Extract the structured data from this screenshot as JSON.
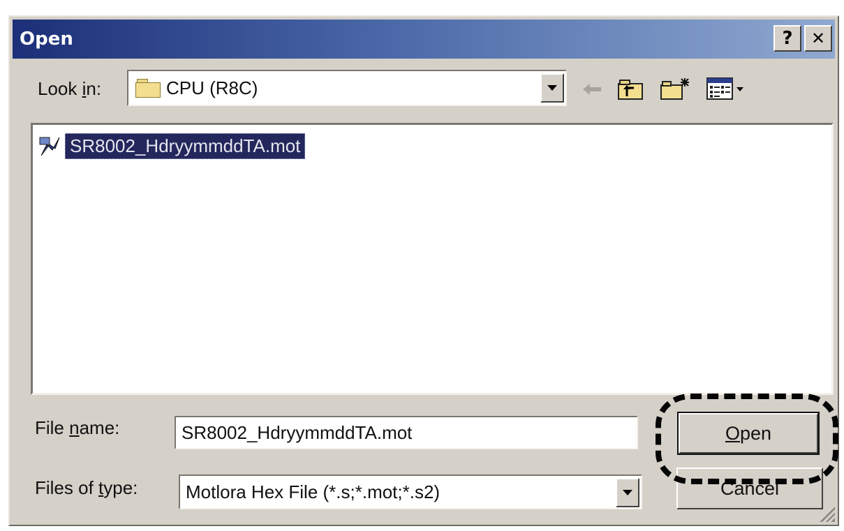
{
  "window": {
    "title": "Open",
    "help_button": "?",
    "close_button": "✕"
  },
  "lookin": {
    "label_pre": "Look ",
    "label_acc": "i",
    "label_post": "n:",
    "value": "CPU (R8C)"
  },
  "toolbar": {
    "back_icon": "back-arrow-icon",
    "up_icon": "up-one-level-icon",
    "new_folder_icon": "new-folder-icon",
    "view_menu_icon": "view-menu-icon"
  },
  "files": [
    {
      "name": "SR8002_HdryymmddTA.mot",
      "selected": true
    }
  ],
  "filename": {
    "label_pre": "File ",
    "label_acc": "n",
    "label_post": "ame:",
    "value": "SR8002_HdryymmddTA.mot"
  },
  "filetype": {
    "label_pre": "Files of ",
    "label_acc": "t",
    "label_post": "ype:",
    "value": "Motlora Hex File (*.s;*.mot;*.s2)"
  },
  "buttons": {
    "open_acc": "O",
    "open_rest": "pen",
    "cancel": "Cancel"
  },
  "colors": {
    "title_start": "#1c2f78",
    "title_end": "#8fa9d0",
    "selection": "#23275c",
    "face": "#d5d0c8"
  }
}
